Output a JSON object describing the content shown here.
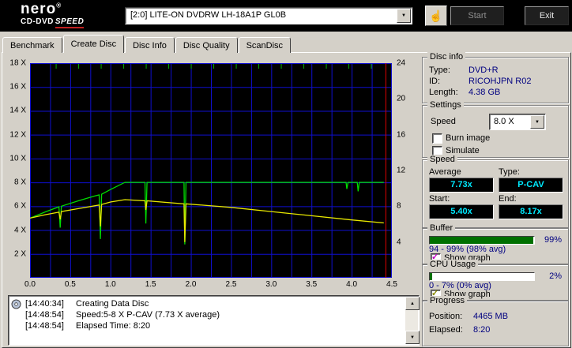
{
  "icons": {
    "dropdown": "▼",
    "scroll_up": "▲",
    "scroll_down": "▼",
    "hand": "☝",
    "check": "✓"
  },
  "header": {
    "logo": {
      "name": "nero",
      "reg": "®",
      "product_a": "CD-DVD",
      "product_b": "SPEED"
    },
    "drive": {
      "value": "[2:0]    LITE-ON DVDRW LH-18A1P GL0B"
    },
    "buttons": {
      "start": "Start",
      "exit": "Exit"
    }
  },
  "tabs": {
    "active": "Create Disc",
    "items": [
      {
        "label": "Benchmark"
      },
      {
        "label": "Create Disc"
      },
      {
        "label": "Disc Info"
      },
      {
        "label": "Disc Quality"
      },
      {
        "label": "ScanDisc"
      }
    ]
  },
  "chart_data": {
    "type": "line",
    "title": "Create Disc write speed graph",
    "background": "#000000",
    "x_axis": {
      "min": 0,
      "max": 4.5,
      "unit": "GB",
      "ticks": [
        {
          "v": 0.0,
          "t": "0.0"
        },
        {
          "v": 0.5,
          "t": "0.5"
        },
        {
          "v": 1.0,
          "t": "1.0"
        },
        {
          "v": 1.5,
          "t": "1.5"
        },
        {
          "v": 2.0,
          "t": "2.0"
        },
        {
          "v": 2.5,
          "t": "2.5"
        },
        {
          "v": 3.0,
          "t": "3.0"
        },
        {
          "v": 3.5,
          "t": "3.5"
        },
        {
          "v": 4.0,
          "t": "4.0"
        },
        {
          "v": 4.5,
          "t": "4.5"
        }
      ]
    },
    "left_axis": {
      "min": 0,
      "max": 18,
      "ticks": [
        {
          "v": 18,
          "t": "18 X"
        },
        {
          "v": 16,
          "t": "16 X"
        },
        {
          "v": 14,
          "t": "14 X"
        },
        {
          "v": 12,
          "t": "12 X"
        },
        {
          "v": 10,
          "t": "10 X"
        },
        {
          "v": 8,
          "t": "8 X"
        },
        {
          "v": 6,
          "t": "6 X"
        },
        {
          "v": 4,
          "t": "4 X"
        },
        {
          "v": 2,
          "t": "2 X"
        }
      ]
    },
    "right_axis": {
      "min": 0,
      "max": 24,
      "ticks": [
        {
          "v": 24,
          "t": "24"
        },
        {
          "v": 20,
          "t": "20"
        },
        {
          "v": 16,
          "t": "16"
        },
        {
          "v": 12,
          "t": "12"
        },
        {
          "v": 8,
          "t": "8"
        },
        {
          "v": 4,
          "t": "4"
        }
      ]
    },
    "grid": {
      "color": "#0f0fd0",
      "x_step": 0.25,
      "y_step": 2
    },
    "top_ticks": {
      "color": "#00b000",
      "positions": [
        0.32,
        0.6,
        0.88,
        1.16,
        1.44,
        1.72,
        2.0,
        2.28,
        2.56,
        2.84,
        3.12,
        3.4,
        3.68,
        3.96,
        4.24
      ]
    },
    "series": [
      {
        "name": "write-speed",
        "color": "#00dc00",
        "axis": "left",
        "points": [
          [
            0,
            5.0
          ],
          [
            0.2,
            5.55
          ],
          [
            0.36,
            5.95
          ],
          [
            0.375,
            4.2
          ],
          [
            0.39,
            6.0
          ],
          [
            0.6,
            6.45
          ],
          [
            0.8,
            6.85
          ],
          [
            0.86,
            6.95
          ],
          [
            0.875,
            3.25
          ],
          [
            0.89,
            7.0
          ],
          [
            1.0,
            7.4
          ],
          [
            1.18,
            8.0
          ],
          [
            1.43,
            8.0
          ],
          [
            1.44,
            4.55
          ],
          [
            1.455,
            8.0
          ],
          [
            1.915,
            8.0
          ],
          [
            1.925,
            2.8
          ],
          [
            1.94,
            8.0
          ],
          [
            3.93,
            8.0
          ],
          [
            3.94,
            7.45
          ],
          [
            3.955,
            8.0
          ],
          [
            4.07,
            8.0
          ],
          [
            4.08,
            7.25
          ],
          [
            4.095,
            8.0
          ],
          [
            4.4,
            8.0
          ]
        ]
      },
      {
        "name": "rotation-speed",
        "color": "#e8e800",
        "axis": "left",
        "points": [
          [
            0,
            5.0
          ],
          [
            0.2,
            5.3
          ],
          [
            0.36,
            5.5
          ],
          [
            0.375,
            4.9
          ],
          [
            0.39,
            5.55
          ],
          [
            0.6,
            5.8
          ],
          [
            0.86,
            6.1
          ],
          [
            0.875,
            4.3
          ],
          [
            0.89,
            6.15
          ],
          [
            1.0,
            6.35
          ],
          [
            1.18,
            6.55
          ],
          [
            1.43,
            6.45
          ],
          [
            1.44,
            5.7
          ],
          [
            1.455,
            6.45
          ],
          [
            1.915,
            6.2
          ],
          [
            1.925,
            3.0
          ],
          [
            1.94,
            6.2
          ],
          [
            2.5,
            5.9
          ],
          [
            3.0,
            5.55
          ],
          [
            3.5,
            5.2
          ],
          [
            4.0,
            4.85
          ],
          [
            4.4,
            4.6
          ]
        ]
      }
    ],
    "position_marker": {
      "x": 4.42,
      "color": "#e00000"
    }
  },
  "panels": {
    "disc_info": {
      "title": "Disc info",
      "rows": [
        {
          "label": "Type:",
          "value": "DVD+R"
        },
        {
          "label": "ID:",
          "value": "RICOHJPN R02"
        },
        {
          "label": "Length:",
          "value": "4.38 GB"
        }
      ]
    },
    "settings": {
      "title": "Settings",
      "speed_label": "Speed",
      "speed_value": "8.0 X",
      "options": [
        {
          "label": "Burn image",
          "checked": false
        },
        {
          "label": "Simulate",
          "checked": false
        }
      ]
    },
    "speed": {
      "title": "Speed",
      "average_label": "Average",
      "average_value": "7.73x",
      "type_label": "Type:",
      "type_value": "P-CAV",
      "start_label": "Start:",
      "start_value": "5.40x",
      "end_label": "End:",
      "end_value": "8.17x"
    },
    "buffer": {
      "title": "Buffer",
      "percent": "99%",
      "fill_pct": 99,
      "range": "94 - 99% (98% avg)",
      "show_graph": "Show graph",
      "graph_color": "#c000c0"
    },
    "cpu": {
      "title": "CPU Usage",
      "percent": "2%",
      "fill_pct": 2,
      "range": "0 - 7% (0% avg)",
      "show_graph": "Show graph",
      "graph_color": "#8a8a00"
    },
    "progress": {
      "title": "Progress",
      "position_label": "Position:",
      "position_value": "4465 MB",
      "elapsed_label": "Elapsed:",
      "elapsed_value": "8:20"
    }
  },
  "log": {
    "entries": [
      {
        "time": "[14:40:34]",
        "text": "Creating Data Disc"
      },
      {
        "time": "[14:48:54]",
        "text": "Speed:5-8 X P-CAV (7.73 X average)"
      },
      {
        "time": "[14:48:54]",
        "text": "Elapsed Time: 8:20"
      }
    ]
  }
}
